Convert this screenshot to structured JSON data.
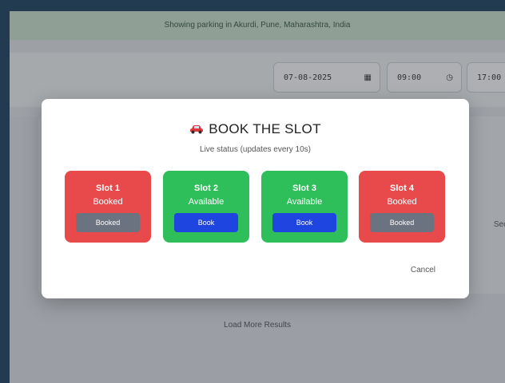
{
  "banner": {
    "text": "Showing parking in Akurdi, Pune, Maharashtra, India"
  },
  "search": {
    "date": "07-08-2025",
    "date_icon": "calendar-icon",
    "start_time": "09:00",
    "start_icon": "clock-icon",
    "end_time": "17:00",
    "end_icon": "clock-icon"
  },
  "results": {
    "partial_label": "Security",
    "load_more": "Load More Results"
  },
  "modal": {
    "icon": "car-icon",
    "title": "BOOK THE SLOT",
    "subtitle": "Live status (updates every 10s)",
    "cancel": "Cancel",
    "colors": {
      "booked_card": "#e84a4c",
      "available_card": "#2fbf5a",
      "book_button": "#1f45e0",
      "booked_button": "#6b7280"
    },
    "slots": [
      {
        "name": "Slot 1",
        "status": "Booked",
        "button": "Booked"
      },
      {
        "name": "Slot 2",
        "status": "Available",
        "button": "Book"
      },
      {
        "name": "Slot 3",
        "status": "Available",
        "button": "Book"
      },
      {
        "name": "Slot 4",
        "status": "Booked",
        "button": "Booked"
      }
    ]
  }
}
